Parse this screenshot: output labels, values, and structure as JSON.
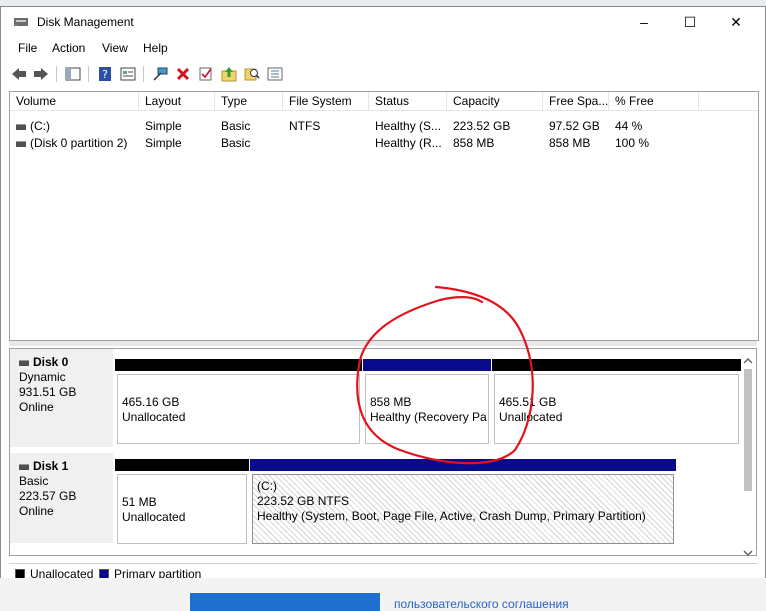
{
  "window": {
    "title": "Disk Management",
    "controls": {
      "minimize": "–",
      "maximize": "☐",
      "close": "✕"
    }
  },
  "menu": [
    "File",
    "Action",
    "View",
    "Help"
  ],
  "toolbar_icons": [
    "back-icon",
    "forward-icon",
    "console-icon",
    "help-icon",
    "properties-icon",
    "connect-icon",
    "delete-icon",
    "check-icon",
    "up-icon",
    "search-icon",
    "list-icon"
  ],
  "volume_list": {
    "columns": [
      "Volume",
      "Layout",
      "Type",
      "File System",
      "Status",
      "Capacity",
      "Free Spa...",
      "% Free"
    ],
    "rows": [
      {
        "volume": "(C:)",
        "layout": "Simple",
        "type": "Basic",
        "fs": "NTFS",
        "status": "Healthy (S...",
        "capacity": "223.52 GB",
        "free": "97.52 GB",
        "pct": "44 %"
      },
      {
        "volume": "(Disk 0 partition 2)",
        "layout": "Simple",
        "type": "Basic",
        "fs": "",
        "status": "Healthy (R...",
        "capacity": "858 MB",
        "free": "858 MB",
        "pct": "100 %"
      }
    ]
  },
  "disks": [
    {
      "name": "Disk 0",
      "kind": "Dynamic",
      "size": "931.51 GB",
      "state": "Online",
      "partitions": [
        {
          "size": "465.16 GB",
          "status": "Unallocated"
        },
        {
          "size": "858 MB",
          "status": "Healthy (Recovery Pa"
        },
        {
          "size": "465.51 GB",
          "status": "Unallocated"
        }
      ]
    },
    {
      "name": "Disk 1",
      "kind": "Basic",
      "size": "223.57 GB",
      "state": "Online",
      "partitions": [
        {
          "size": "51 MB",
          "status": "Unallocated"
        },
        {
          "label": "(C:)",
          "size": "223.52 GB NTFS",
          "status": "Healthy (System, Boot, Page File, Active, Crash Dump, Primary Partition)"
        }
      ]
    }
  ],
  "legend": [
    {
      "label": "Unallocated",
      "color": "#000000"
    },
    {
      "label": "Primary partition",
      "color": "#00008b"
    }
  ],
  "background_text": "пользовательского соглашения",
  "colors": {
    "unallocated": "#000000",
    "primary": "#0a0a8c",
    "annotation": "#e0141c"
  }
}
